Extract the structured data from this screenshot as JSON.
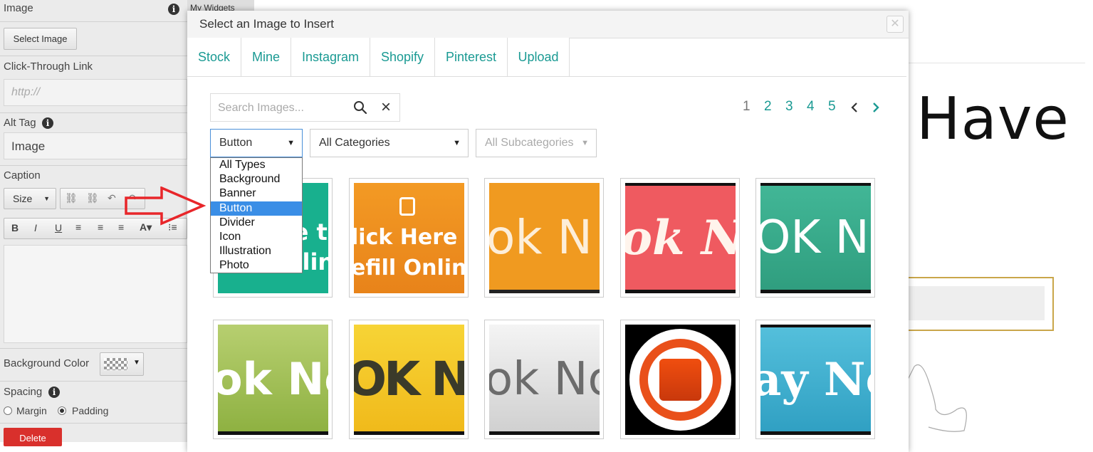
{
  "left_panel": {
    "image_label": "Image",
    "select_image_button": "Select Image",
    "click_through_label": "Click-Through Link",
    "link_placeholder": "http://",
    "alt_tag_label": "Alt Tag",
    "alt_tag_value": "Image",
    "caption_label": "Caption",
    "size_label": "Size",
    "background_color_label": "Background Color",
    "spacing_label": "Spacing",
    "margin_label": "Margin",
    "padding_label": "Padding",
    "spacing_selected": "Padding",
    "delete_button": "Delete"
  },
  "my_widgets_tab": "My Widgets",
  "background_page": {
    "heading": "Have"
  },
  "modal": {
    "title": "Select an Image to Insert",
    "close_icon": "close-icon",
    "tabs": [
      {
        "label": "Stock",
        "active": true
      },
      {
        "label": "Mine"
      },
      {
        "label": "Instagram"
      },
      {
        "label": "Shopify"
      },
      {
        "label": "Pinterest"
      },
      {
        "label": "Upload"
      }
    ],
    "search": {
      "placeholder": "Search Images...",
      "value": ""
    },
    "pagination": {
      "current": "1",
      "pages": [
        "2",
        "3",
        "4",
        "5"
      ],
      "prev_icon": "chevron-left-icon",
      "next_icon": "chevron-right-icon"
    },
    "type_select": {
      "value": "Button",
      "options": [
        "All Types",
        "Background",
        "Banner",
        "Button",
        "Divider",
        "Icon",
        "Illustration",
        "Photo"
      ]
    },
    "category_select": {
      "value": "All Categories"
    },
    "subcategory_select": {
      "value": "All Subcategories",
      "disabled": true
    },
    "thumbnails": [
      {
        "text": "ck Here to\nefill Onlin",
        "bg": "#18b08e"
      },
      {
        "text": "lick Here t\nefill Onlin",
        "bg": "#f0901e"
      },
      {
        "text": "ok N",
        "bg": "#f09a20"
      },
      {
        "text": "ok N",
        "bg": "#ef5a60"
      },
      {
        "text": "OK N",
        "bg": "#3cb08e"
      },
      {
        "text": "ok No",
        "bg": "#9bbf4a"
      },
      {
        "text": "OK NO",
        "bg": "#f3c31e"
      },
      {
        "text": "ok No",
        "bg": "#dedede"
      },
      {
        "text": "",
        "bg": "#000000"
      },
      {
        "text": "ay No",
        "bg": "#3fb0cf"
      }
    ]
  },
  "colors": {
    "accent": "#1a9a93",
    "selection": "#3a8ee6",
    "arrow": "#e8262a"
  }
}
